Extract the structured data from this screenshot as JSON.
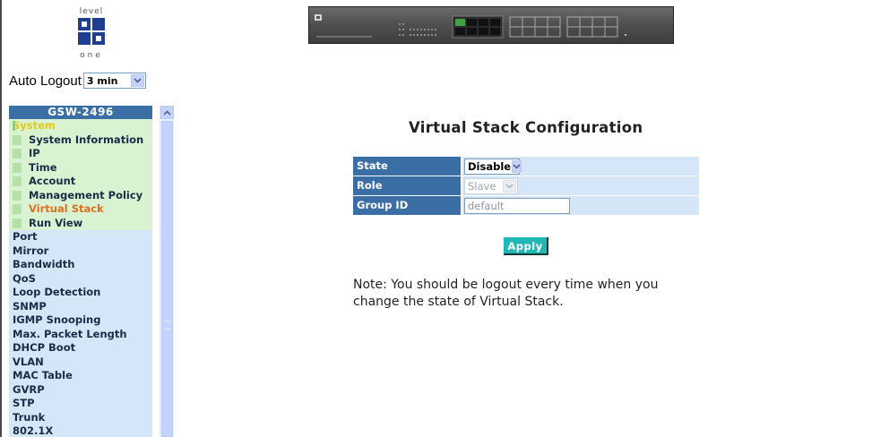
{
  "logo": {
    "top_word": "level",
    "bottom_word": "one"
  },
  "auto_logout": {
    "label": "Auto Logout",
    "value": "3 min"
  },
  "menu": {
    "title": "GSW-2496",
    "items": [
      {
        "label": "System",
        "kind": "system"
      },
      {
        "label": "System Information",
        "kind": "sub"
      },
      {
        "label": "IP",
        "kind": "sub"
      },
      {
        "label": "Time",
        "kind": "sub"
      },
      {
        "label": "Account",
        "kind": "sub"
      },
      {
        "label": "Management Policy",
        "kind": "sub"
      },
      {
        "label": "Virtual Stack",
        "kind": "sub",
        "active": true
      },
      {
        "label": "Run View",
        "kind": "sub"
      },
      {
        "label": "Port",
        "kind": "top"
      },
      {
        "label": "Mirror",
        "kind": "top"
      },
      {
        "label": "Bandwidth",
        "kind": "top"
      },
      {
        "label": "QoS",
        "kind": "top"
      },
      {
        "label": "Loop Detection",
        "kind": "top"
      },
      {
        "label": "SNMP",
        "kind": "top"
      },
      {
        "label": "IGMP Snooping",
        "kind": "top"
      },
      {
        "label": "Max. Packet Length",
        "kind": "top"
      },
      {
        "label": "DHCP Boot",
        "kind": "top"
      },
      {
        "label": "VLAN",
        "kind": "top"
      },
      {
        "label": "MAC Table",
        "kind": "top"
      },
      {
        "label": "GVRP",
        "kind": "top"
      },
      {
        "label": "STP",
        "kind": "top"
      },
      {
        "label": "Trunk",
        "kind": "top"
      },
      {
        "label": "802.1X",
        "kind": "top"
      }
    ]
  },
  "main": {
    "title": "Virtual Stack Configuration",
    "rows": {
      "state": {
        "label": "State",
        "value": "Disable"
      },
      "role": {
        "label": "Role",
        "value": "Slave"
      },
      "group_id": {
        "label": "Group ID",
        "value": "default"
      }
    },
    "apply_label": "Apply",
    "note": "Note: You should be logout every time when you change the state of Virtual Stack."
  },
  "colors": {
    "header_blue": "#3a6ea5",
    "light_blue": "#d4e6f8",
    "apply_teal": "#21b7b5",
    "active_orange": "#e07020",
    "system_yellow": "#e0cd14"
  }
}
